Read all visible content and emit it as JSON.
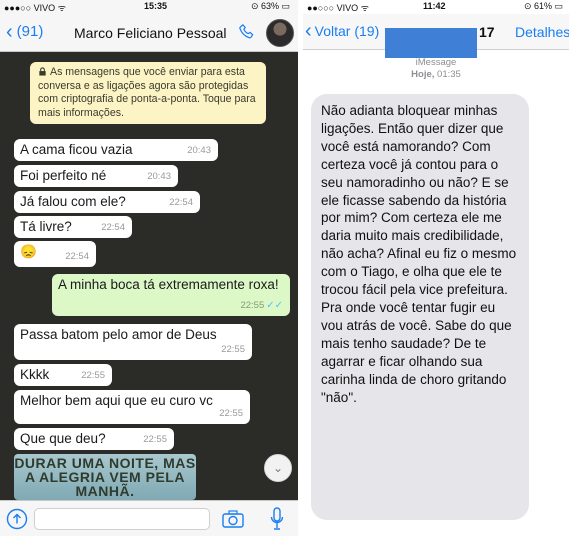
{
  "whatsapp": {
    "status_bar": {
      "carrier": "●●●○○ VIVO ᯤ",
      "time": "15:35",
      "battery": "⊙ 63% ▭"
    },
    "header": {
      "back_label": "(91)",
      "contact_name": "Marco Feliciano Pessoal"
    },
    "encryption_notice": "As mensagens que você enviar para esta conversa e as ligações agora são protegidas com criptografia de ponta-a-ponta. Toque para mais informações.",
    "messages": [
      {
        "text": "A cama ficou vazia",
        "time": "20:43"
      },
      {
        "text": "Foi perfeito né",
        "time": "20:43"
      },
      {
        "text": "Já falou com ele?",
        "time": "22:54"
      },
      {
        "text": "Tá livre?",
        "time": "22:54"
      },
      {
        "text": "😞",
        "time": "22:54"
      },
      {
        "text": "A minha boca tá extremamente roxa!",
        "time": "22:55",
        "outgoing": true
      },
      {
        "text": "Passa batom pelo amor de Deus",
        "time": "22:55"
      },
      {
        "text": "Kkkk",
        "time": "22:55"
      },
      {
        "text": "Melhor bem aqui que eu curo vc",
        "time": "22:55"
      },
      {
        "text": "Que que deu?",
        "time": "22:55"
      }
    ],
    "sticker_text": "DURAR UMA NOITE, MAS A ALEGRIA VEM PELA MANHÃ.",
    "ticks": "✓✓",
    "scroll_down_glyph": "⌄"
  },
  "imessage": {
    "status_bar": {
      "carrier": "●●○○○ VIVO ᯤ",
      "time": "11:42",
      "battery": "⊙ 61% ▭"
    },
    "header": {
      "back_label": "Voltar (19)",
      "contact_tail": "17",
      "details_label": "Detalhes"
    },
    "meta": {
      "service": "iMessage",
      "day": "Hoje,",
      "time": "01:35"
    },
    "message": "Não adianta bloquear minhas ligações. Então quer dizer que você está namorando? Com certeza você já contou para o seu namoradinho ou não? E se ele ficasse sabendo da história por mim? Com certeza ele me daria muito mais credibilidade, não acha? Afinal eu fiz o mesmo com o Tiago, e olha que ele te trocou fácil pela vice prefeitura. Pra onde você tentar fugir eu vou atrás de você. Sabe do que mais tenho saudade? De te agarrar e ficar olhando sua carinha linda de choro gritando \"não\".",
    "redaction_color": "#3f7fd6"
  },
  "colors": {
    "wa_bg": "#2b2c28",
    "wa_bubble_out": "#dcf8c6",
    "wa_notice": "#fdf4c5",
    "ios_blue": "#1a7ef2",
    "im_bubble": "#e5e5ea"
  },
  "icons": [
    "chevron-left-icon",
    "phone-icon",
    "lock-icon",
    "chevron-down-icon",
    "share-icon",
    "camera-icon",
    "microphone-icon"
  ]
}
